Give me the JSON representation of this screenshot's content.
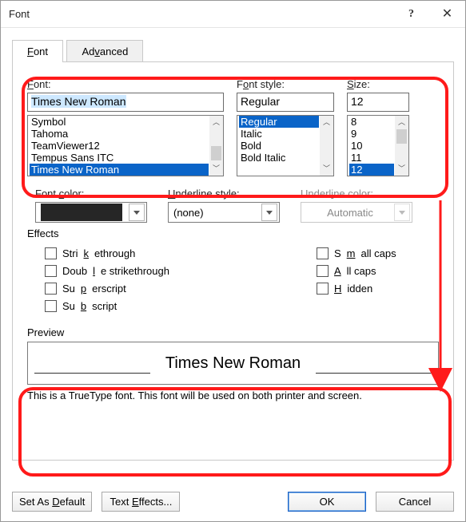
{
  "window": {
    "title": "Font"
  },
  "tabs": {
    "font": "Font",
    "advanced": "Advanced"
  },
  "labels": {
    "font": "Font:",
    "style": "Font style:",
    "size": "Size:",
    "color": "Font color:",
    "underline": "Underline style:",
    "ucolor": "Underline color:",
    "effects": "Effects",
    "preview": "Preview"
  },
  "font": {
    "value": "Times New Roman",
    "list": [
      "Symbol",
      "Tahoma",
      "TeamViewer12",
      "Tempus Sans ITC",
      "Times New Roman"
    ],
    "selected": "Times New Roman"
  },
  "style": {
    "value": "Regular",
    "list": [
      "Regular",
      "Italic",
      "Bold",
      "Bold Italic"
    ],
    "selected": "Regular"
  },
  "size": {
    "value": "12",
    "list": [
      "8",
      "9",
      "10",
      "11",
      "12"
    ],
    "selected": "12"
  },
  "underline_style": "(none)",
  "underline_color": "Automatic",
  "effects": {
    "strike": "Strikethrough",
    "dblstrike": "Double strikethrough",
    "super": "Superscript",
    "sub": "Subscript",
    "smallcaps": "Small caps",
    "allcaps": "All caps",
    "hidden": "Hidden"
  },
  "preview_text": "Times New Roman",
  "hint": "This is a TrueType font. This font will be used on both printer and screen.",
  "buttons": {
    "default": "Set As Default",
    "texteffects": "Text Effects...",
    "ok": "OK",
    "cancel": "Cancel"
  }
}
